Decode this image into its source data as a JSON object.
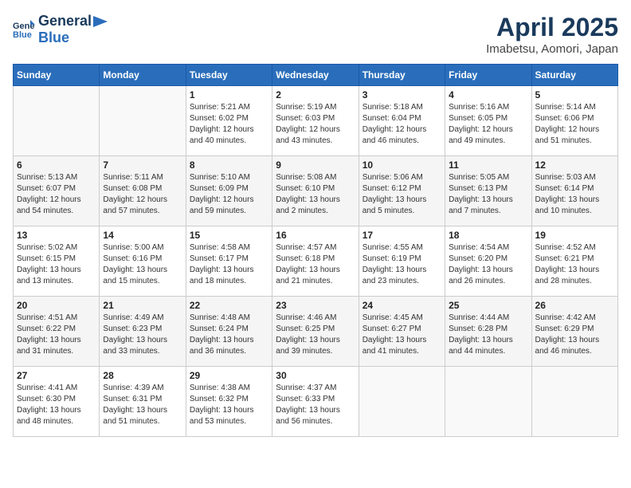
{
  "logo": {
    "line1": "General",
    "line2": "Blue"
  },
  "title": "April 2025",
  "subtitle": "Imabetsu, Aomori, Japan",
  "weekdays": [
    "Sunday",
    "Monday",
    "Tuesday",
    "Wednesday",
    "Thursday",
    "Friday",
    "Saturday"
  ],
  "weeks": [
    [
      {
        "day": "",
        "sunrise": "",
        "sunset": "",
        "daylight": ""
      },
      {
        "day": "",
        "sunrise": "",
        "sunset": "",
        "daylight": ""
      },
      {
        "day": "1",
        "sunrise": "Sunrise: 5:21 AM",
        "sunset": "Sunset: 6:02 PM",
        "daylight": "Daylight: 12 hours and 40 minutes."
      },
      {
        "day": "2",
        "sunrise": "Sunrise: 5:19 AM",
        "sunset": "Sunset: 6:03 PM",
        "daylight": "Daylight: 12 hours and 43 minutes."
      },
      {
        "day": "3",
        "sunrise": "Sunrise: 5:18 AM",
        "sunset": "Sunset: 6:04 PM",
        "daylight": "Daylight: 12 hours and 46 minutes."
      },
      {
        "day": "4",
        "sunrise": "Sunrise: 5:16 AM",
        "sunset": "Sunset: 6:05 PM",
        "daylight": "Daylight: 12 hours and 49 minutes."
      },
      {
        "day": "5",
        "sunrise": "Sunrise: 5:14 AM",
        "sunset": "Sunset: 6:06 PM",
        "daylight": "Daylight: 12 hours and 51 minutes."
      }
    ],
    [
      {
        "day": "6",
        "sunrise": "Sunrise: 5:13 AM",
        "sunset": "Sunset: 6:07 PM",
        "daylight": "Daylight: 12 hours and 54 minutes."
      },
      {
        "day": "7",
        "sunrise": "Sunrise: 5:11 AM",
        "sunset": "Sunset: 6:08 PM",
        "daylight": "Daylight: 12 hours and 57 minutes."
      },
      {
        "day": "8",
        "sunrise": "Sunrise: 5:10 AM",
        "sunset": "Sunset: 6:09 PM",
        "daylight": "Daylight: 12 hours and 59 minutes."
      },
      {
        "day": "9",
        "sunrise": "Sunrise: 5:08 AM",
        "sunset": "Sunset: 6:10 PM",
        "daylight": "Daylight: 13 hours and 2 minutes."
      },
      {
        "day": "10",
        "sunrise": "Sunrise: 5:06 AM",
        "sunset": "Sunset: 6:12 PM",
        "daylight": "Daylight: 13 hours and 5 minutes."
      },
      {
        "day": "11",
        "sunrise": "Sunrise: 5:05 AM",
        "sunset": "Sunset: 6:13 PM",
        "daylight": "Daylight: 13 hours and 7 minutes."
      },
      {
        "day": "12",
        "sunrise": "Sunrise: 5:03 AM",
        "sunset": "Sunset: 6:14 PM",
        "daylight": "Daylight: 13 hours and 10 minutes."
      }
    ],
    [
      {
        "day": "13",
        "sunrise": "Sunrise: 5:02 AM",
        "sunset": "Sunset: 6:15 PM",
        "daylight": "Daylight: 13 hours and 13 minutes."
      },
      {
        "day": "14",
        "sunrise": "Sunrise: 5:00 AM",
        "sunset": "Sunset: 6:16 PM",
        "daylight": "Daylight: 13 hours and 15 minutes."
      },
      {
        "day": "15",
        "sunrise": "Sunrise: 4:58 AM",
        "sunset": "Sunset: 6:17 PM",
        "daylight": "Daylight: 13 hours and 18 minutes."
      },
      {
        "day": "16",
        "sunrise": "Sunrise: 4:57 AM",
        "sunset": "Sunset: 6:18 PM",
        "daylight": "Daylight: 13 hours and 21 minutes."
      },
      {
        "day": "17",
        "sunrise": "Sunrise: 4:55 AM",
        "sunset": "Sunset: 6:19 PM",
        "daylight": "Daylight: 13 hours and 23 minutes."
      },
      {
        "day": "18",
        "sunrise": "Sunrise: 4:54 AM",
        "sunset": "Sunset: 6:20 PM",
        "daylight": "Daylight: 13 hours and 26 minutes."
      },
      {
        "day": "19",
        "sunrise": "Sunrise: 4:52 AM",
        "sunset": "Sunset: 6:21 PM",
        "daylight": "Daylight: 13 hours and 28 minutes."
      }
    ],
    [
      {
        "day": "20",
        "sunrise": "Sunrise: 4:51 AM",
        "sunset": "Sunset: 6:22 PM",
        "daylight": "Daylight: 13 hours and 31 minutes."
      },
      {
        "day": "21",
        "sunrise": "Sunrise: 4:49 AM",
        "sunset": "Sunset: 6:23 PM",
        "daylight": "Daylight: 13 hours and 33 minutes."
      },
      {
        "day": "22",
        "sunrise": "Sunrise: 4:48 AM",
        "sunset": "Sunset: 6:24 PM",
        "daylight": "Daylight: 13 hours and 36 minutes."
      },
      {
        "day": "23",
        "sunrise": "Sunrise: 4:46 AM",
        "sunset": "Sunset: 6:25 PM",
        "daylight": "Daylight: 13 hours and 39 minutes."
      },
      {
        "day": "24",
        "sunrise": "Sunrise: 4:45 AM",
        "sunset": "Sunset: 6:27 PM",
        "daylight": "Daylight: 13 hours and 41 minutes."
      },
      {
        "day": "25",
        "sunrise": "Sunrise: 4:44 AM",
        "sunset": "Sunset: 6:28 PM",
        "daylight": "Daylight: 13 hours and 44 minutes."
      },
      {
        "day": "26",
        "sunrise": "Sunrise: 4:42 AM",
        "sunset": "Sunset: 6:29 PM",
        "daylight": "Daylight: 13 hours and 46 minutes."
      }
    ],
    [
      {
        "day": "27",
        "sunrise": "Sunrise: 4:41 AM",
        "sunset": "Sunset: 6:30 PM",
        "daylight": "Daylight: 13 hours and 48 minutes."
      },
      {
        "day": "28",
        "sunrise": "Sunrise: 4:39 AM",
        "sunset": "Sunset: 6:31 PM",
        "daylight": "Daylight: 13 hours and 51 minutes."
      },
      {
        "day": "29",
        "sunrise": "Sunrise: 4:38 AM",
        "sunset": "Sunset: 6:32 PM",
        "daylight": "Daylight: 13 hours and 53 minutes."
      },
      {
        "day": "30",
        "sunrise": "Sunrise: 4:37 AM",
        "sunset": "Sunset: 6:33 PM",
        "daylight": "Daylight: 13 hours and 56 minutes."
      },
      {
        "day": "",
        "sunrise": "",
        "sunset": "",
        "daylight": ""
      },
      {
        "day": "",
        "sunrise": "",
        "sunset": "",
        "daylight": ""
      },
      {
        "day": "",
        "sunrise": "",
        "sunset": "",
        "daylight": ""
      }
    ]
  ]
}
